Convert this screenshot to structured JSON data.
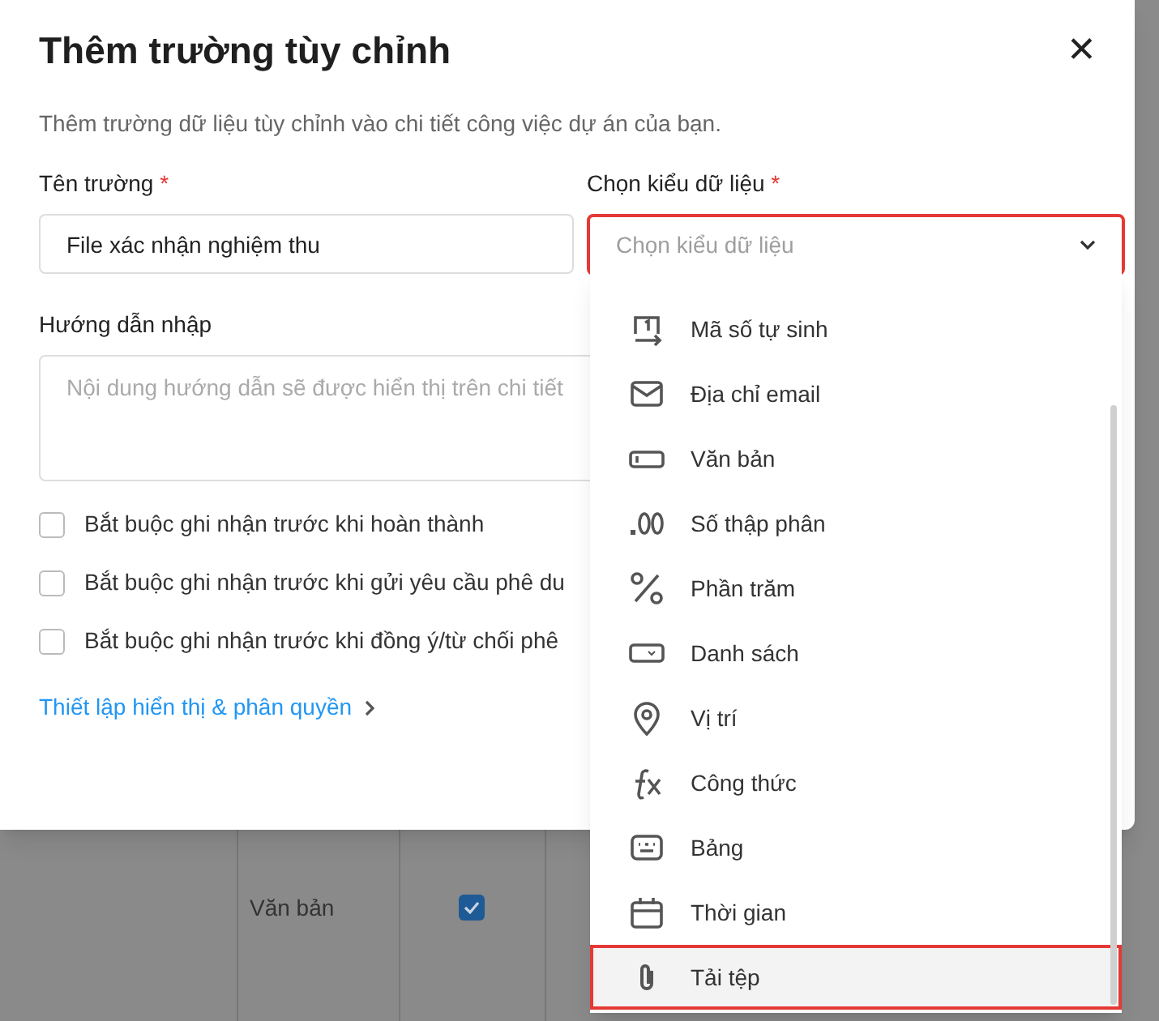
{
  "background": {
    "cells": [
      {
        "text": "Văn bản",
        "checked": true
      }
    ]
  },
  "dialog": {
    "title": "Thêm trường tùy chỉnh",
    "close": "✕",
    "description": "Thêm trường dữ liệu tùy chỉnh vào chi tiết công việc dự án của bạn.",
    "name_field": {
      "label": "Tên trường",
      "required": "*",
      "value": "File xác nhận nghiệm thu"
    },
    "type_field": {
      "label": "Chọn kiểu dữ liệu",
      "required": "*",
      "placeholder": "Chọn kiểu dữ liệu",
      "expanded": true,
      "highlighted": true
    },
    "hint_field": {
      "label": "Hướng dẫn nhập",
      "placeholder": "Nội dung hướng dẫn sẽ được hiển thị trên chi tiết"
    },
    "checkboxes": [
      {
        "label": "Bắt buộc ghi nhận trước khi hoàn thành",
        "checked": false
      },
      {
        "label": "Bắt buộc ghi nhận trước khi gửi yêu cầu phê du",
        "checked": false
      },
      {
        "label": "Bắt buộc ghi nhận trước khi đồng ý/từ chối phê",
        "checked": false
      }
    ],
    "link": {
      "label": "Thiết lập hiển thị & phân quyền"
    }
  },
  "dropdown": {
    "items": [
      {
        "kind": "autonumber",
        "label": "Mã số tự sinh",
        "highlighted": false
      },
      {
        "kind": "email",
        "label": "Địa chỉ email",
        "highlighted": false
      },
      {
        "kind": "text",
        "label": "Văn bản",
        "highlighted": false
      },
      {
        "kind": "decimal",
        "label": "Số thập phân",
        "highlighted": false
      },
      {
        "kind": "percent",
        "label": "Phần trăm",
        "highlighted": false
      },
      {
        "kind": "list",
        "label": "Danh sách",
        "highlighted": false
      },
      {
        "kind": "location",
        "label": "Vị trí",
        "highlighted": false
      },
      {
        "kind": "formula",
        "label": "Công thức",
        "highlighted": false
      },
      {
        "kind": "table",
        "label": "Bảng",
        "highlighted": false
      },
      {
        "kind": "time",
        "label": "Thời gian",
        "highlighted": false
      },
      {
        "kind": "attachment",
        "label": "Tải tệp",
        "highlighted": true
      }
    ]
  }
}
